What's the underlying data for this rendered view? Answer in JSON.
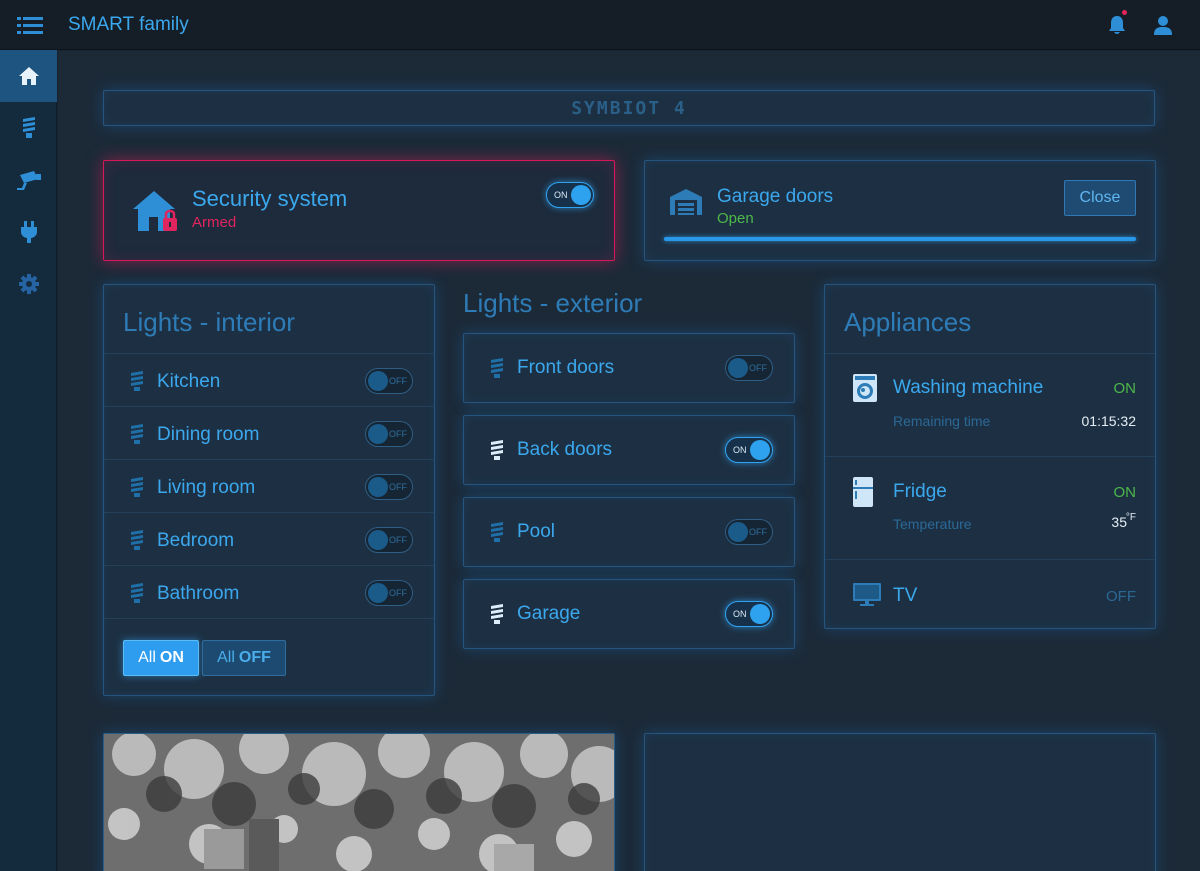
{
  "app": {
    "title": "SMART family"
  },
  "brand": "SYMBIOT 4",
  "sidebar": {
    "items": [
      {
        "name": "home",
        "icon": "home-icon",
        "active": true
      },
      {
        "name": "lights",
        "icon": "bulb-icon",
        "active": false
      },
      {
        "name": "cameras",
        "icon": "camera-icon",
        "active": false
      },
      {
        "name": "plugs",
        "icon": "plug-icon",
        "active": false
      },
      {
        "name": "settings",
        "icon": "gear-icon",
        "active": false
      }
    ]
  },
  "security": {
    "title": "Security system",
    "status": "Armed",
    "toggle": "ON"
  },
  "garage": {
    "title": "Garage doors",
    "status": "Open",
    "button": "Close",
    "progress": 1.0
  },
  "interior": {
    "title": "Lights - interior",
    "rows": [
      {
        "label": "Kitchen",
        "toggle": "OFF"
      },
      {
        "label": "Dining room",
        "toggle": "OFF"
      },
      {
        "label": "Living room",
        "toggle": "OFF"
      },
      {
        "label": "Bedroom",
        "toggle": "OFF"
      },
      {
        "label": "Bathroom",
        "toggle": "OFF"
      }
    ],
    "btn_all_on_prefix": "All",
    "btn_all_on_strong": "ON",
    "btn_all_off_prefix": "All",
    "btn_all_off_strong": "OFF"
  },
  "exterior": {
    "title": "Lights - exterior",
    "rows": [
      {
        "label": "Front doors",
        "toggle": "OFF"
      },
      {
        "label": "Back doors",
        "toggle": "ON"
      },
      {
        "label": "Pool",
        "toggle": "OFF"
      },
      {
        "label": "Garage",
        "toggle": "ON"
      }
    ]
  },
  "appliances": {
    "title": "Appliances",
    "washing": {
      "name": "Washing machine",
      "state": "ON",
      "sub_label": "Remaining time",
      "sub_value": "01:15:32"
    },
    "fridge": {
      "name": "Fridge",
      "state": "ON",
      "sub_label": "Temperature",
      "sub_value": "35",
      "unit": "°F"
    },
    "tv": {
      "name": "TV",
      "state": "OFF"
    }
  },
  "colors": {
    "accent": "#3ba8ee",
    "alert": "#e0245e",
    "ok": "#4cb848",
    "muted": "#2b6896"
  }
}
